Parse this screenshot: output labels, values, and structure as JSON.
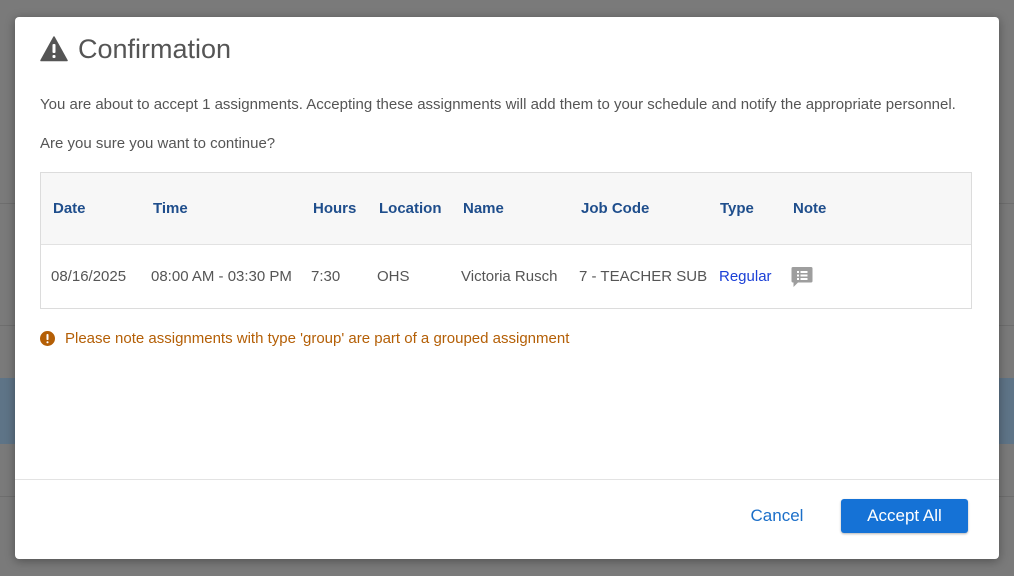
{
  "dialog": {
    "title": "Confirmation",
    "message": "You are about to accept 1 assignments. Accepting these assignments will add them to your schedule and notify the appropriate personnel.",
    "question": "Are you sure you want to continue?"
  },
  "table": {
    "headers": {
      "date": "Date",
      "time": "Time",
      "hours": "Hours",
      "location": "Location",
      "name": "Name",
      "job_code": "Job Code",
      "type": "Type",
      "note": "Note"
    },
    "rows": [
      {
        "date": "08/16/2025",
        "time": "08:00 AM - 03:30 PM",
        "hours": "7:30",
        "location": "OHS",
        "name": "Victoria Rusch",
        "job_code": "7 - TEACHER SUB",
        "type": "Regular",
        "note_icon": "comment-list-icon"
      }
    ]
  },
  "notice": {
    "text": "Please note assignments with type 'group' are part of a grouped assignment",
    "icon": "info-circle-icon"
  },
  "footer": {
    "cancel_label": "Cancel",
    "accept_label": "Accept All"
  },
  "colors": {
    "header_text": "#1f4e8c",
    "type_link": "#1a3fd6",
    "notice_text": "#b45f06",
    "primary_button": "#1572d6",
    "cancel_text": "#1b6fc9"
  },
  "icons": {
    "title_icon": "warning-icon"
  }
}
